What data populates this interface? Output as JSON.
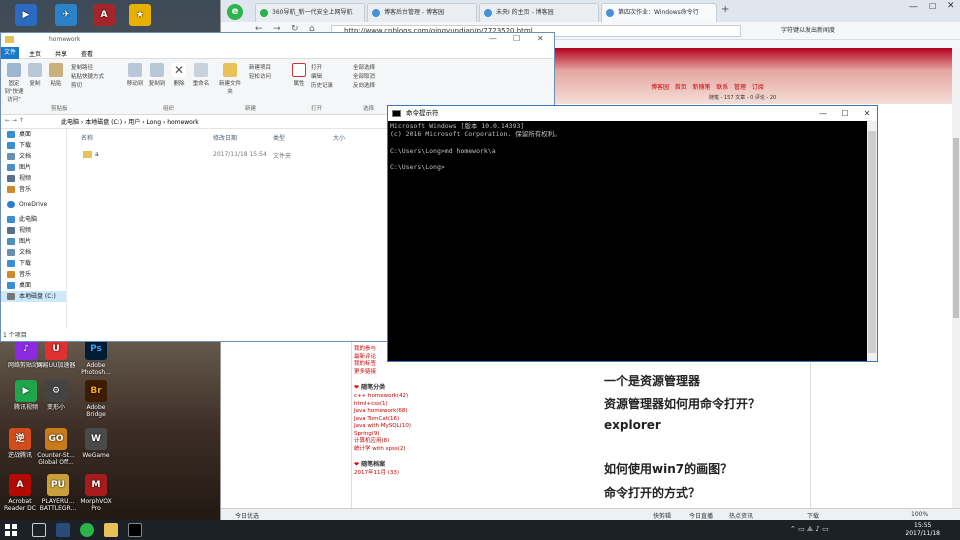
{
  "desktop_icons": [
    {
      "label": "",
      "color": "#1e66b8"
    },
    {
      "label": "",
      "color": "#c0202a"
    },
    {
      "label": "",
      "color": "#2a7a3a"
    },
    {
      "label": "",
      "color": "#d22"
    },
    {
      "label": "",
      "color": "#caa21c"
    },
    {
      "label": "",
      "color": "#d0a000"
    },
    {
      "label": "网络剪贴动画",
      "color": "#8a2be2"
    },
    {
      "label": "网易UU加速器",
      "color": "#e03030"
    },
    {
      "label": "Adobe Photosh...",
      "color": "#001d34"
    },
    {
      "label": "腾讯视频",
      "color": "#1fa64a"
    },
    {
      "label": "变形小",
      "color": "#444"
    },
    {
      "label": "Adobe Bridge",
      "color": "#3d1c00"
    },
    {
      "label": "逆战腾讯",
      "color": "#d34c1a"
    },
    {
      "label": "Counter-St... Global Off...",
      "color": "#c97a1a"
    },
    {
      "label": "WeGame",
      "color": "#4a4a4a"
    },
    {
      "label": "Acrobat Reader DC",
      "color": "#b30b00"
    },
    {
      "label": "PLAYERU... BATTLEGR...",
      "color": "#c9a03c"
    },
    {
      "label": "MorphVOX Pro",
      "color": "#a61c1c"
    }
  ],
  "browser": {
    "tabs": [
      {
        "label": "360导航_新一代安全上网导航",
        "color": "#2cb34a",
        "active": false
      },
      {
        "label": "博客后台管理 - 博客园",
        "color": "#4a90d9",
        "active": false
      },
      {
        "label": "未央I 的主页 - 博客园",
        "color": "#4a90d9",
        "active": false
      },
      {
        "label": "第四次作业：Windows命令行",
        "color": "#4a90d9",
        "active": true
      }
    ],
    "url": "http://www.cnblogs.com/qingyundian/p/7723520.html",
    "url_right": "字符键以发出新闻度",
    "blog_nav": [
      "博客园",
      "首页",
      "新随笔",
      "联系",
      "管理",
      "订阅"
    ],
    "blog_stats": "随笔 - 157  文章 - 0  评论 - 20",
    "sidebar_links_top": [
      "我的参与",
      "最新评论",
      "我的标签",
      "更多链接"
    ],
    "category_title": "随笔分类",
    "categories": [
      "c++ homework(42)",
      "html+css(1)",
      "Java homework(68)",
      "Java TomCat(16)",
      "Java with MySQL(10)",
      "Spring(9)",
      "计算机应用(8)",
      "统计学 with spss(2)"
    ],
    "archive_title": "随笔档案",
    "archives": [
      "2017年11月 (33)"
    ],
    "article_lines": [
      "一个是资源管理器",
      "资源管理器如何用命令打开？",
      "explorer",
      "如何使用win7的画图？",
      "命令打开的方式？"
    ],
    "status_left": "今日优选",
    "status_items": [
      "快剪辑",
      "今日直播",
      "热点资讯",
      "下载",
      "100%"
    ]
  },
  "explorer": {
    "title": "homework",
    "menu": [
      "文件",
      "主页",
      "共享",
      "查看"
    ],
    "ribbon": {
      "clipboard_buttons": [
        "固定到\"快速访问\"",
        "复制",
        "粘贴"
      ],
      "clipboard_small": [
        "复制路径",
        "粘贴快捷方式",
        "剪切"
      ],
      "organize_buttons": [
        "移动到",
        "复制到",
        "删除",
        "重命名"
      ],
      "new_buttons": [
        "新建文件夹"
      ],
      "new_small": [
        "新建项目",
        "轻松访问"
      ],
      "open_buttons": [
        "属性"
      ],
      "open_small": [
        "打开",
        "编辑",
        "历史记录"
      ],
      "select_small": [
        "全部选择",
        "全部取消",
        "反向选择"
      ],
      "groups": [
        "剪贴板",
        "组织",
        "新建",
        "打开",
        "选择"
      ]
    },
    "path": [
      "此电脑",
      "本地磁盘 (C:)",
      "用户",
      "Long",
      "homework"
    ],
    "nav": [
      {
        "label": "桌面",
        "color": "#3b8ed0"
      },
      {
        "label": "下载",
        "color": "#3b8ed0"
      },
      {
        "label": "文档",
        "color": "#6a8fb0"
      },
      {
        "label": "图片",
        "color": "#4a90c0"
      },
      {
        "label": "视频",
        "color": "#5a6f8a"
      },
      {
        "label": "音乐",
        "color": "#d08a2a"
      },
      {
        "label": "OneDrive",
        "color": "#2b7cd3"
      },
      {
        "label": "此电脑",
        "color": "#3b8ed0"
      },
      {
        "label": "视频",
        "color": "#5a6f8a"
      },
      {
        "label": "图片",
        "color": "#4a90c0"
      },
      {
        "label": "文档",
        "color": "#6a8fb0"
      },
      {
        "label": "下载",
        "color": "#3b8ed0"
      },
      {
        "label": "音乐",
        "color": "#d08a2a"
      },
      {
        "label": "桌面",
        "color": "#3b8ed0"
      },
      {
        "label": "本地磁盘 (C:)",
        "color": "#777"
      }
    ],
    "columns": [
      "名称",
      "修改日期",
      "类型",
      "大小"
    ],
    "files": [
      {
        "name": "a",
        "date": "2017/11/18 15:54",
        "type": "文件夹",
        "size": ""
      }
    ],
    "status": "1 个项目"
  },
  "cmd": {
    "title": "命令提示符",
    "lines": [
      "Microsoft Windows [版本 10.0.14393]",
      "(c) 2016 Microsoft Corporation. 保留所有权利。",
      "",
      "C:\\Users\\Long>md homework\\a",
      "",
      "C:\\Users\\Long>"
    ]
  },
  "taskbar": {
    "time": "15:55",
    "date": "2017/11/18"
  }
}
